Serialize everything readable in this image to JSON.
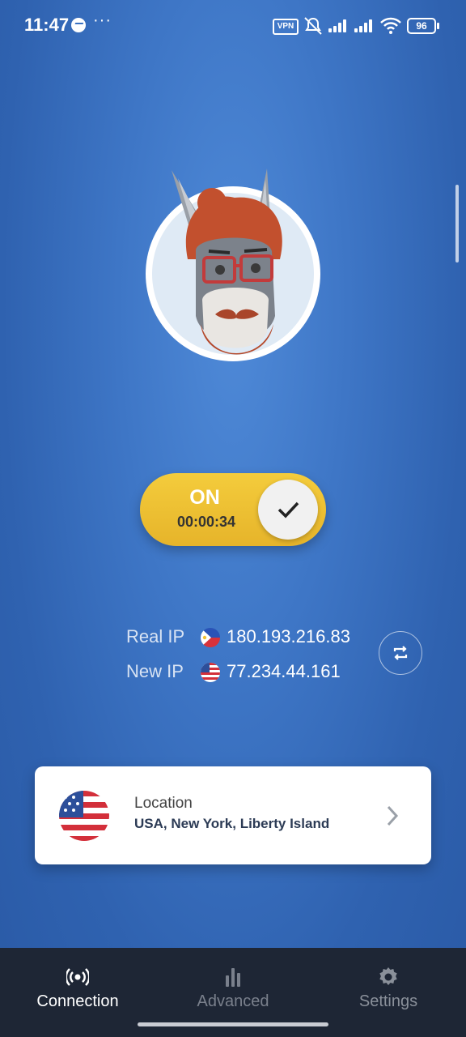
{
  "status_bar": {
    "time": "11:47",
    "more": "···",
    "vpn_badge": "VPN",
    "battery": "96",
    "icons": [
      "messenger-icon",
      "vpn-icon",
      "mute-bell-icon",
      "signal-icon",
      "signal-icon",
      "wifi-icon",
      "battery-icon"
    ]
  },
  "connection": {
    "state": "ON",
    "timer": "00:00:34",
    "toggle_color": "#f0c232"
  },
  "ip": {
    "real_label": "Real IP",
    "real_value": "180.193.216.83",
    "real_flag": "philippines-flag",
    "new_label": "New IP",
    "new_value": "77.234.44.161",
    "new_flag": "usa-flag"
  },
  "location": {
    "label": "Location",
    "value": "USA, New York, Liberty Island"
  },
  "nav": {
    "items": [
      {
        "label": "Connection",
        "icon": "broadcast-icon",
        "active": true
      },
      {
        "label": "Advanced",
        "icon": "bar-chart-icon",
        "active": false
      },
      {
        "label": "Settings",
        "icon": "gear-icon",
        "active": false
      }
    ]
  },
  "colors": {
    "background": "#3e76c6",
    "toggle": "#f0c232",
    "navbar": "#1e2635"
  }
}
